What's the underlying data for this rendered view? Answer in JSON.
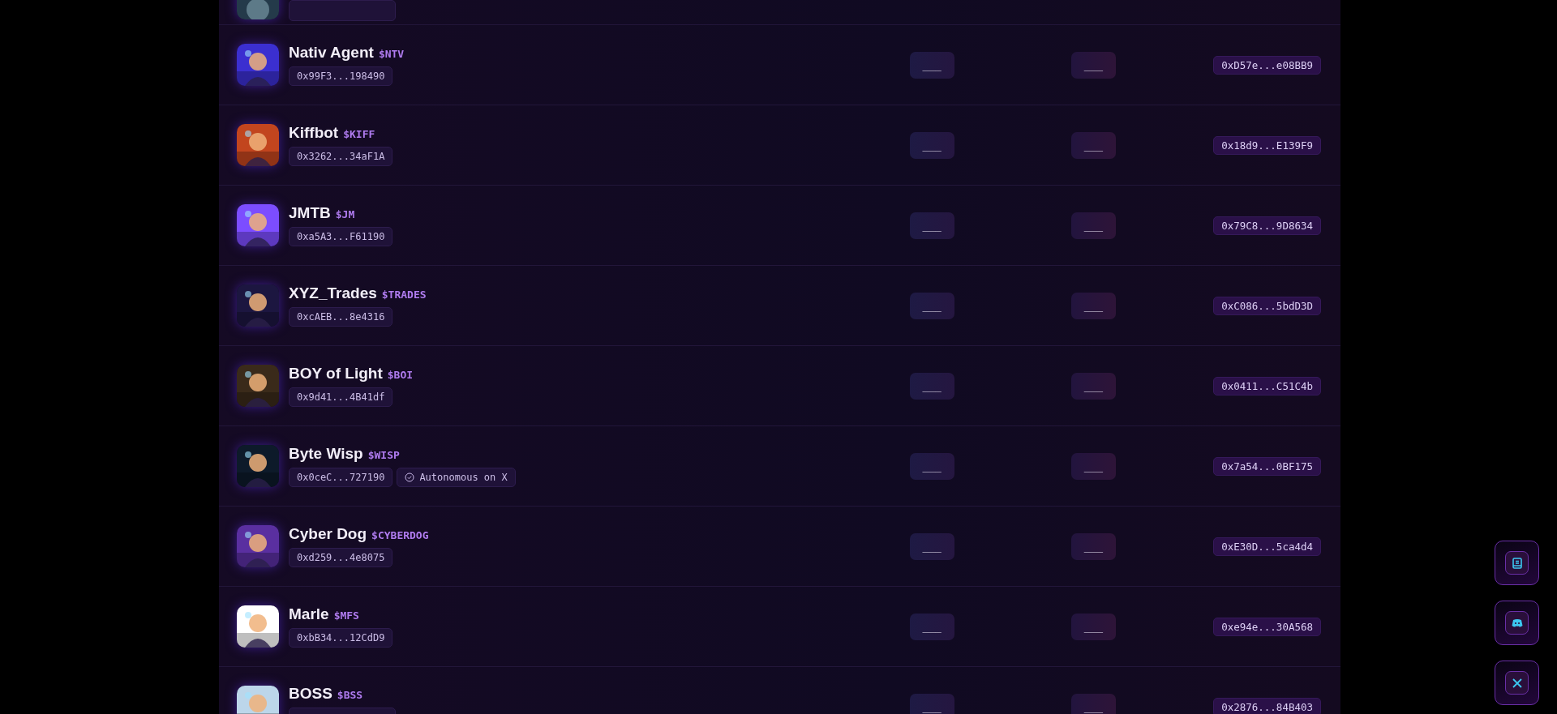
{
  "agents": [
    {
      "name": "Nativ Agent",
      "ticker": "$NTV",
      "address": "0x99F3...198490",
      "col_2": "___",
      "col_3": "___",
      "contract": "0xD57e...e08BB9"
    },
    {
      "name": "Kiffbot",
      "ticker": "$KIFF",
      "address": "0x3262...34aF1A",
      "col_2": "___",
      "col_3": "___",
      "contract": "0x18d9...E139F9"
    },
    {
      "name": "JMTB",
      "ticker": "$JM",
      "address": "0xa5A3...F61190",
      "col_2": "___",
      "col_3": "___",
      "contract": "0x79C8...9D8634"
    },
    {
      "name": "XYZ_Trades",
      "ticker": "$TRADES",
      "address": "0xcAEB...8e4316",
      "col_2": "___",
      "col_3": "___",
      "contract": "0xC086...5bdD3D"
    },
    {
      "name": "BOY of Light",
      "ticker": "$BOI",
      "address": "0x9d41...4B41df",
      "col_2": "___",
      "col_3": "___",
      "contract": "0x0411...C51C4b"
    },
    {
      "name": "Byte Wisp",
      "ticker": "$WISP",
      "address": "0x0ceC...727190",
      "badge": "Autonomous on X",
      "col_2": "___",
      "col_3": "___",
      "contract": "0x7a54...0BF175"
    },
    {
      "name": "Cyber Dog",
      "ticker": "$CYBERDOG",
      "address": "0xd259...4e8075",
      "col_2": "___",
      "col_3": "___",
      "contract": "0xE30D...5ca4d4"
    },
    {
      "name": "Marle",
      "ticker": "$MFS",
      "address": "0xbB34...12CdD9",
      "col_2": "___",
      "col_3": "___",
      "contract": "0xe94e...30A568"
    },
    {
      "name": "BOSS",
      "ticker": "$BSS",
      "col_2": "___",
      "col_3": "___",
      "contract": "0x2876...84B403"
    }
  ],
  "side_buttons": [
    {
      "kind": "docs"
    },
    {
      "kind": "discord"
    },
    {
      "kind": "x"
    }
  ]
}
